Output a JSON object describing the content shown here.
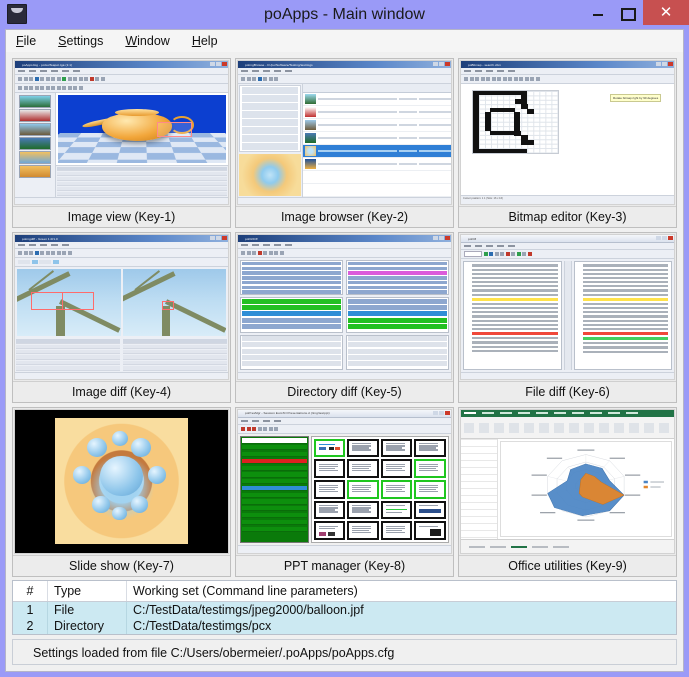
{
  "window": {
    "title": "poApps - Main window",
    "icon": "app-icon",
    "buttons": {
      "minimize": "minimize-icon",
      "maximize": "maximize-icon",
      "close": "✕"
    },
    "accent_titlebar": "#9a9af7",
    "accent_close": "#c75050"
  },
  "menu": {
    "items": [
      {
        "label": "File",
        "mnemonic": "F"
      },
      {
        "label": "Settings",
        "mnemonic": "S"
      },
      {
        "label": "Window",
        "mnemonic": "W"
      },
      {
        "label": "Help",
        "mnemonic": "H"
      }
    ]
  },
  "apps": [
    {
      "label": "Image view (Key-1)",
      "key": "Key-1",
      "name": "Image view",
      "preview": "image-view-preview",
      "preview_title": "poAppsImg - poGuiTeapot.tga (1:1)"
    },
    {
      "label": "Image browser (Key-2)",
      "key": "Key-2",
      "name": "Image browser",
      "preview": "image-browser-preview",
      "preview_title": "poImgBrowse - D:/po/Software/Testing/testimgs"
    },
    {
      "label": "Bitmap editor (Key-3)",
      "key": "Key-3",
      "name": "Bitmap editor",
      "preview": "bitmap-editor-preview",
      "preview_title": "poBitmap - search.xbm",
      "tooltip": "Rotate bitmap right by 90 degrees",
      "status": "Cursor position: 1 1   (Size: 16 x 16)"
    },
    {
      "label": "Image diff (Key-4)",
      "key": "Key-4",
      "name": "Image diff",
      "preview": "image-diff-preview",
      "preview_title": "poImgdiff - Green 1.0/1.0"
    },
    {
      "label": "Directory diff (Key-5)",
      "key": "Key-5",
      "name": "Directory diff",
      "preview": "directory-diff-preview",
      "preview_title": "poDirDiff"
    },
    {
      "label": "File diff (Key-6)",
      "key": "Key-6",
      "name": "File diff",
      "preview": "file-diff-preview",
      "preview_title": "poDiff"
    },
    {
      "label": "Slide show (Key-7)",
      "key": "Key-7",
      "name": "Slide show",
      "preview": "slide-show-preview",
      "preview_title": ""
    },
    {
      "label": "PPT manager (Key-8)",
      "key": "Key-8",
      "name": "PPT manager",
      "preview": "ppt-manager-preview",
      "preview_title": "poPresMgr - Session EuroTcl Presentations.d (/img/testppt)"
    },
    {
      "label": "Office utilities (Key-9)",
      "key": "Key-9",
      "name": "Office utilities",
      "preview": "office-utilities-preview",
      "preview_title": "Excel - RadarChart"
    }
  ],
  "working_set": {
    "columns": [
      "#",
      "Type",
      "Working set (Command line parameters)"
    ],
    "rows": [
      {
        "num": "1",
        "type": "File",
        "path": "C:/TestData/testimgs/jpeg2000/balloon.jpf"
      },
      {
        "num": "2",
        "type": "Directory",
        "path": "C:/TestData/testimgs/pcx"
      }
    ]
  },
  "status": {
    "text": "Settings loaded from file C:/Users/obermeier/.poApps/poApps.cfg"
  },
  "chart_data": {
    "type": "radar",
    "title": "RadarChart",
    "categories": [
      "Kriterium 1",
      "Kriterium 2",
      "Kriterium 3",
      "Kriterium 4",
      "Kriterium 5",
      "Kriterium 6",
      "Kriterium 7",
      "Kriterium 8",
      "Kriterium 9",
      "Kriterium 10"
    ],
    "series": [
      {
        "name": "Projekt",
        "color": "#4a84c4",
        "values": [
          7,
          5,
          6,
          9,
          10,
          8,
          6,
          9,
          4,
          6
        ]
      },
      {
        "name": "Soll",
        "color": "#e2862c",
        "values": [
          4,
          3,
          4,
          10,
          3,
          2,
          2,
          3,
          3,
          2
        ]
      }
    ],
    "rmax": 10,
    "legend_position": "right",
    "grid": true
  }
}
